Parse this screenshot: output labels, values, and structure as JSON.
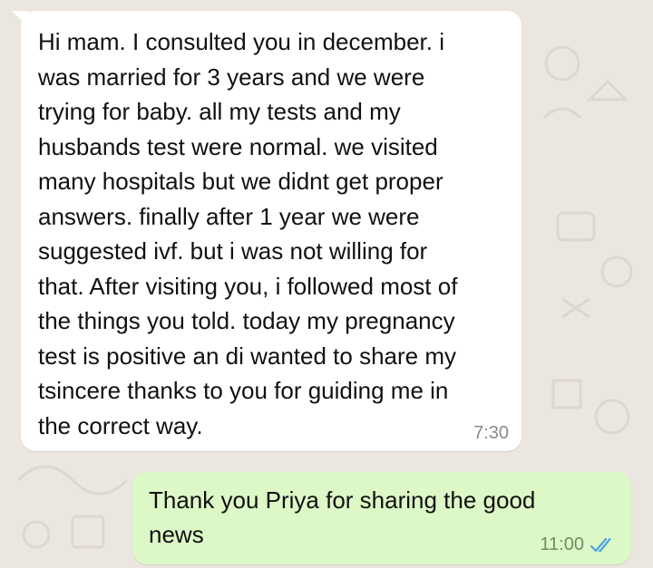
{
  "colors": {
    "chat_background": "#ebe6df",
    "incoming_bubble": "#ffffff",
    "outgoing_bubble": "#dcf8c6",
    "read_ticks": "#4fa3e0"
  },
  "messages": [
    {
      "direction": "incoming",
      "text": "Hi mam. I consulted you in december. i\nwas married for 3 years and we were\ntrying for baby. all my tests and my\nhusbands test were normal. we visited\nmany hospitals but we didnt get proper\nanswers. finally after 1 year we were\nsuggested ivf. but i was not willing for\nthat. After visiting you, i followed most of\nthe things you told. today my pregnancy\ntest is positive an di wanted to share my\ntsincere thanks to you for guiding me in\nthe correct way.",
      "time": "7:30"
    },
    {
      "direction": "outgoing",
      "text": "Thank you Priya for sharing the good\nnews",
      "time": "11:00",
      "status_icon": "double-check-read-icon"
    }
  ]
}
